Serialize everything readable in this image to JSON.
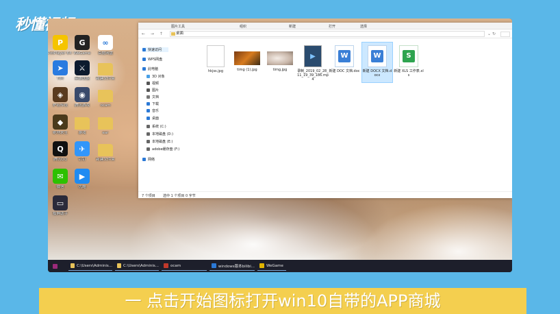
{
  "brand": {
    "logo_text": "秒懂视频"
  },
  "desktop_icons": [
    {
      "label": "PotPlayer 64 bit",
      "icon": "potplayer-icon",
      "color": "#f5c400",
      "glyph": "P"
    },
    {
      "label": "WeGame",
      "icon": "wegame-icon",
      "color": "#222222",
      "glyph": "G"
    },
    {
      "label": "百度网盘",
      "icon": "baidu-netdisk-icon",
      "color": "#ffffff",
      "glyph": "∞"
    },
    {
      "label": "TIM",
      "icon": "tim-icon",
      "color": "#2a7be0",
      "glyph": "➤"
    },
    {
      "label": "英雄联盟",
      "icon": "lol-icon",
      "color": "#0d1b2e",
      "glyph": "⚔"
    },
    {
      "label": "新建文件夹",
      "icon": "folder-icon",
      "color": "#e8c35a",
      "glyph": ""
    },
    {
      "label": "炉石传说",
      "icon": "hearthstone-icon",
      "color": "#5a3b1f",
      "glyph": "◈"
    },
    {
      "label": "腾讯游戏",
      "icon": "tencent-game-icon",
      "color": "#3a4a6b",
      "glyph": "◉"
    },
    {
      "label": "ocam",
      "icon": "folder-icon",
      "color": "#e8c35a",
      "glyph": ""
    },
    {
      "label": "绝地求生",
      "icon": "pubg-icon",
      "color": "#4a3a1c",
      "glyph": "◆"
    },
    {
      "label": "游戏",
      "icon": "folder-icon",
      "color": "#e8c35a",
      "glyph": ""
    },
    {
      "label": "ear",
      "icon": "folder-icon",
      "color": "#e8c35a",
      "glyph": ""
    },
    {
      "label": "腾讯QQ",
      "icon": "qq-icon",
      "color": "#111111",
      "glyph": "Q"
    },
    {
      "label": "钉钉",
      "icon": "dingtalk-icon",
      "color": "#3296fa",
      "glyph": "✈"
    },
    {
      "label": "新建文件夹",
      "icon": "folder-icon",
      "color": "#e8c35a",
      "glyph": ""
    },
    {
      "label": "微信",
      "icon": "wechat-icon",
      "color": "#2dc100",
      "glyph": "✉"
    },
    {
      "label": "优酷",
      "icon": "youku-icon",
      "color": "#1f8bf2",
      "glyph": "▶"
    },
    {
      "label": "投屏助手",
      "icon": "cast-icon",
      "color": "#2a2a3a",
      "glyph": "▭"
    }
  ],
  "explorer": {
    "ribbon_tabs": [
      "图片工具",
      "组织",
      "新建",
      "打开",
      "选择"
    ],
    "nav_buttons": "← → ↑",
    "path": "桌面",
    "refresh": "↻",
    "nav_items": [
      {
        "label": "快速访问",
        "icon": "star-icon",
        "color": "#2b79d6"
      },
      {
        "label": "WPS网盘",
        "icon": "cloud-icon",
        "color": "#2b79d6"
      },
      {
        "label": "此电脑",
        "icon": "computer-icon",
        "color": "#2b79d6"
      },
      {
        "label": "3D 对象",
        "icon": "3d-objects-icon",
        "color": "#4aa0e6"
      },
      {
        "label": "视频",
        "icon": "video-icon",
        "color": "#555555"
      },
      {
        "label": "图片",
        "icon": "pictures-icon",
        "color": "#555555"
      },
      {
        "label": "文档",
        "icon": "documents-icon",
        "color": "#777777"
      },
      {
        "label": "下载",
        "icon": "download-icon",
        "color": "#2b79d6"
      },
      {
        "label": "音乐",
        "icon": "music-icon",
        "color": "#2b79d6"
      },
      {
        "label": "桌面",
        "icon": "desktop-icon",
        "color": "#2b79d6"
      },
      {
        "label": "系统 (C:)",
        "icon": "drive-icon",
        "color": "#666666"
      },
      {
        "label": "本地磁盘 (D:)",
        "icon": "drive-icon",
        "color": "#666666"
      },
      {
        "label": "本地磁盘 (E:)",
        "icon": "drive-icon",
        "color": "#666666"
      },
      {
        "label": "adobe缓存盘 (F:)",
        "icon": "drive-icon",
        "color": "#666666"
      },
      {
        "label": "网络",
        "icon": "network-icon",
        "color": "#2b79d6"
      }
    ],
    "files": [
      {
        "name": "hkjss.jpg",
        "kind": "blank"
      },
      {
        "name": "timg (1).jpg",
        "kind": "image-game"
      },
      {
        "name": "timg.jpg",
        "kind": "image-cat"
      },
      {
        "name": "录制_2019_02_28_11_19_39_186.mp4",
        "kind": "video"
      },
      {
        "name": "新建 DOC 文档.doc",
        "kind": "wps-doc"
      },
      {
        "name": "新建 DOCX 文档.docx",
        "kind": "wps-doc"
      },
      {
        "name": "新建 XLS 工作表.xls",
        "kind": "wps-xls"
      }
    ],
    "status_count": "7 个项目",
    "status_selection": "选中 1 个项目  0 字节"
  },
  "taskbar": {
    "items": [
      {
        "label": "",
        "icon": "start-icon",
        "color": "#9b2a7a"
      },
      {
        "label": "C:\\Users\\Adminis...",
        "icon": "folder-icon",
        "color": "#e8c35a"
      },
      {
        "label": "C:\\Users\\Adminis...",
        "icon": "folder-icon",
        "color": "#e8c35a"
      },
      {
        "label": "ocam",
        "icon": "ocam-icon",
        "color": "#c0392b"
      },
      {
        "label": "windows版本bilibi...",
        "icon": "browser-icon",
        "color": "#2b79d6"
      },
      {
        "label": "WeGame",
        "icon": "wegame-icon",
        "color": "#e0b400"
      }
    ]
  },
  "caption": {
    "text": "一 点击开始图标打开win10自带的APP商城"
  }
}
